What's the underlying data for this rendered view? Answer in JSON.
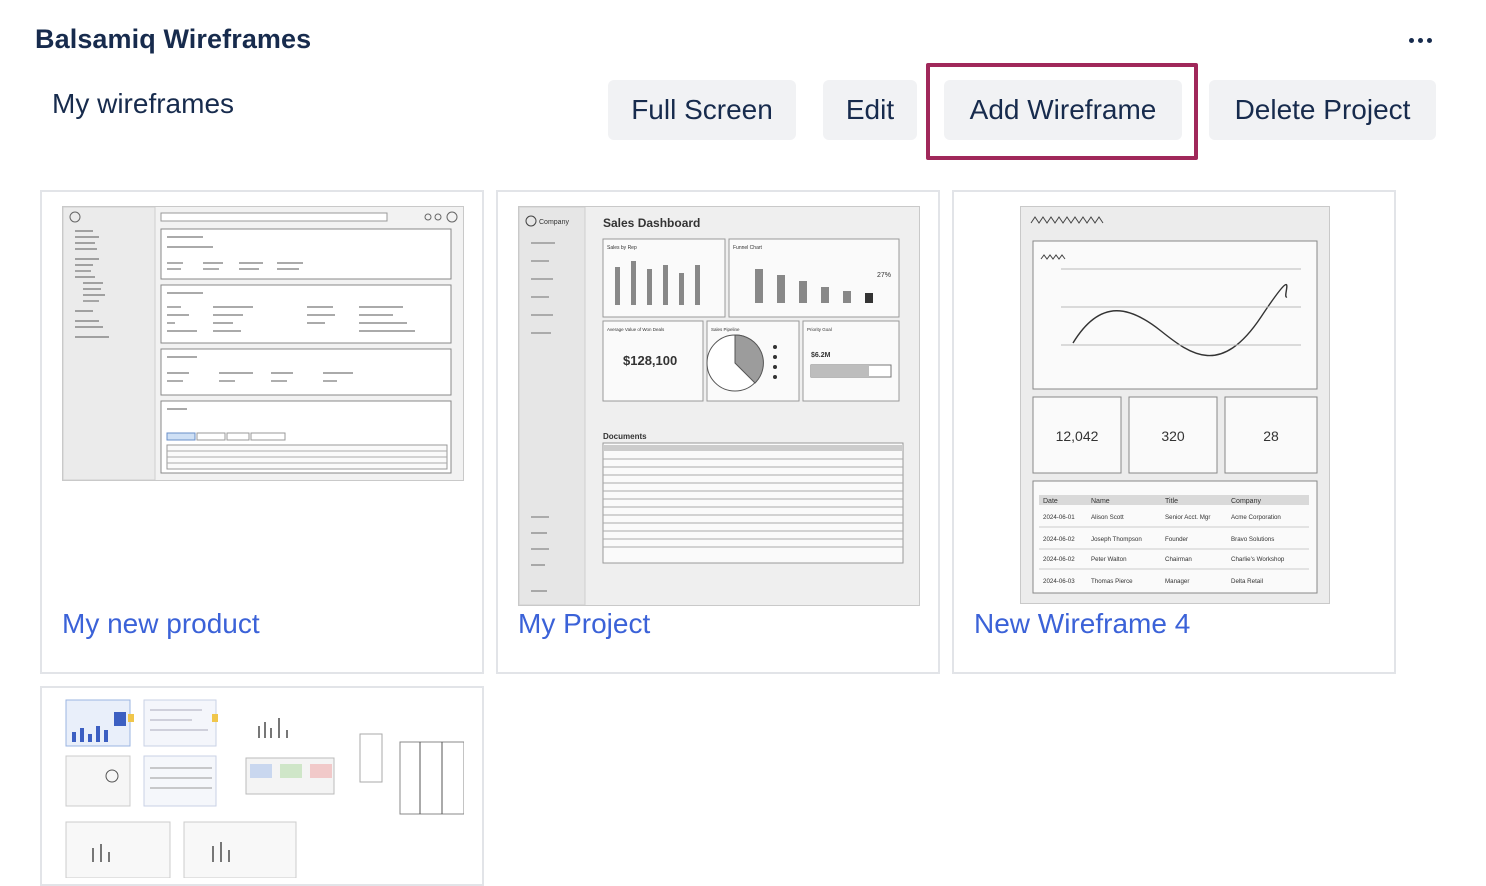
{
  "header": {
    "app_title": "Balsamiq Wireframes",
    "more_label": "More actions"
  },
  "project": {
    "name": "My wireframes"
  },
  "toolbar": {
    "full_screen": "Full Screen",
    "edit": "Edit",
    "add_wireframe": "Add Wireframe",
    "delete_project": "Delete Project"
  },
  "colors": {
    "accent_link": "#3b62d8",
    "highlight_border": "#a0285a",
    "button_bg": "#f1f2f4"
  },
  "wireframes": [
    {
      "title": "My new product"
    },
    {
      "title": "My Project",
      "preview": {
        "company": "Company",
        "heading": "Sales Dashboard",
        "metric_value": "$128,100",
        "metric_label": "Average Value of Won Deals",
        "pipeline_label": "Sales Pipeline",
        "priority_label": "Priority Goal",
        "priority_value": "$6.2M",
        "funnel_label": "Funnel Chart",
        "funnel_pct": "27%",
        "sales_by_rep": "Sales by Rep",
        "documents": "Documents"
      }
    },
    {
      "title": "New Wireframe 4",
      "preview": {
        "stats": [
          "12,042",
          "320",
          "28"
        ],
        "columns": [
          "Date",
          "Name",
          "Title",
          "Company"
        ],
        "rows": [
          [
            "2024-06-01",
            "Alison Scott",
            "Senior Acct. Mgr",
            "Acme Corporation"
          ],
          [
            "2024-06-02",
            "Joseph Thompson",
            "Founder",
            "Bravo Solutions"
          ],
          [
            "2024-06-02",
            "Peter Walton",
            "Chairman",
            "Charlie's Workshop"
          ],
          [
            "2024-06-03",
            "Thomas Pierce",
            "Manager",
            "Delta Retail"
          ]
        ]
      }
    },
    {
      "title": ""
    }
  ]
}
